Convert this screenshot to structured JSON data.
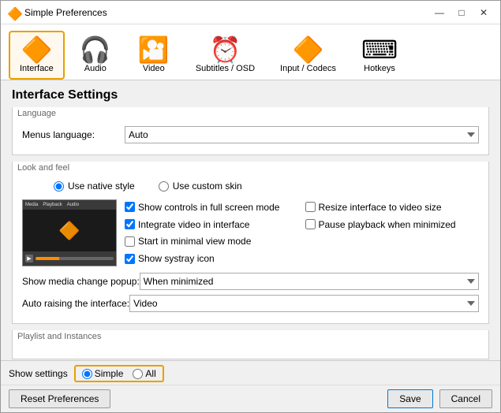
{
  "window": {
    "title": "Simple Preferences",
    "title_icon": "🔶"
  },
  "titlebar": {
    "minimize_label": "—",
    "maximize_label": "□",
    "close_label": "✕"
  },
  "nav": {
    "items": [
      {
        "id": "interface",
        "label": "Interface",
        "icon": "🔶",
        "active": true
      },
      {
        "id": "audio",
        "label": "Audio",
        "icon": "🎧",
        "active": false
      },
      {
        "id": "video",
        "label": "Video",
        "icon": "🎦",
        "active": false
      },
      {
        "id": "subtitles",
        "label": "Subtitles / OSD",
        "icon": "⏰",
        "active": false
      },
      {
        "id": "input",
        "label": "Input / Codecs",
        "icon": "🔶",
        "active": false
      },
      {
        "id": "hotkeys",
        "label": "Hotkeys",
        "icon": "⌨",
        "active": false
      }
    ]
  },
  "main": {
    "section_title": "Interface Settings",
    "language_group": {
      "label": "Language",
      "menus_language_label": "Menus language:",
      "menus_language_value": "Auto"
    },
    "look_group": {
      "label": "Look and feel",
      "radio_native": "Use native style",
      "radio_custom": "Use custom skin",
      "checkboxes": [
        {
          "label": "Show controls in full screen mode",
          "checked": true
        },
        {
          "label": "Resize interface to video size",
          "checked": false
        },
        {
          "label": "Integrate video in interface",
          "checked": true
        },
        {
          "label": "Pause playback when minimized",
          "checked": false
        },
        {
          "label": "Start in minimal view mode",
          "checked": false
        },
        {
          "label": "Show systray icon",
          "checked": true
        }
      ],
      "show_media_popup_label": "Show media change popup:",
      "show_media_popup_value": "When minimized",
      "auto_raising_label": "Auto raising the interface:",
      "auto_raising_value": "Video"
    },
    "playlist_group": {
      "label": "Playlist and Instances"
    }
  },
  "bottom": {
    "show_settings_label": "Show settings",
    "simple_label": "Simple",
    "all_label": "All",
    "reset_label": "Reset Preferences",
    "save_label": "Save",
    "cancel_label": "Cancel"
  }
}
